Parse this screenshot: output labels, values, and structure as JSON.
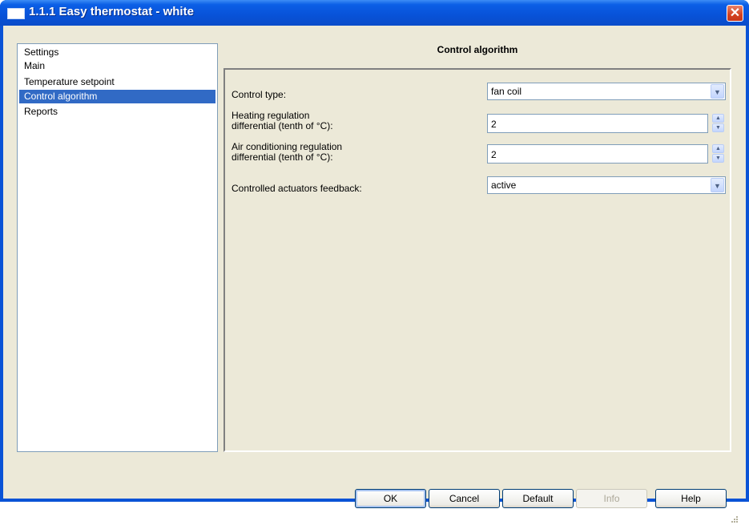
{
  "window": {
    "title": "1.1.1 Easy thermostat - white",
    "close_glyph": "✕"
  },
  "tree": {
    "items": [
      {
        "label": "Settings"
      },
      {
        "label": "Main"
      },
      {
        "label": "Temperature setpoint"
      },
      {
        "label": "Control algorithm",
        "selected": true
      },
      {
        "label": "Reports"
      }
    ]
  },
  "panel": {
    "title": "Control algorithm",
    "fields": {
      "control_type": {
        "label": "Control type:",
        "value": "fan coil"
      },
      "heating_diff": {
        "label_line1": "Heating regulation",
        "label_line2": "differential (tenth of °C):",
        "value": "2"
      },
      "ac_diff": {
        "label_line1": "Air conditioning regulation",
        "label_line2": "differential (tenth of °C):",
        "value": "2"
      },
      "actuators_feedback": {
        "label": "Controlled actuators feedback:",
        "value": "active"
      }
    }
  },
  "buttons": {
    "ok": "OK",
    "cancel": "Cancel",
    "default": "Default",
    "info": "Info",
    "help": "Help"
  },
  "icons": {
    "title": "window-icon",
    "close": "close-icon",
    "dropdown": "chevron-down-icon",
    "spin_up": "chevron-up-icon",
    "spin_down": "chevron-down-icon"
  },
  "colors": {
    "titlebar": "#0a53d6",
    "selection": "#316ac5",
    "dialog_bg": "#ece9d8",
    "close": "#d3411f"
  }
}
